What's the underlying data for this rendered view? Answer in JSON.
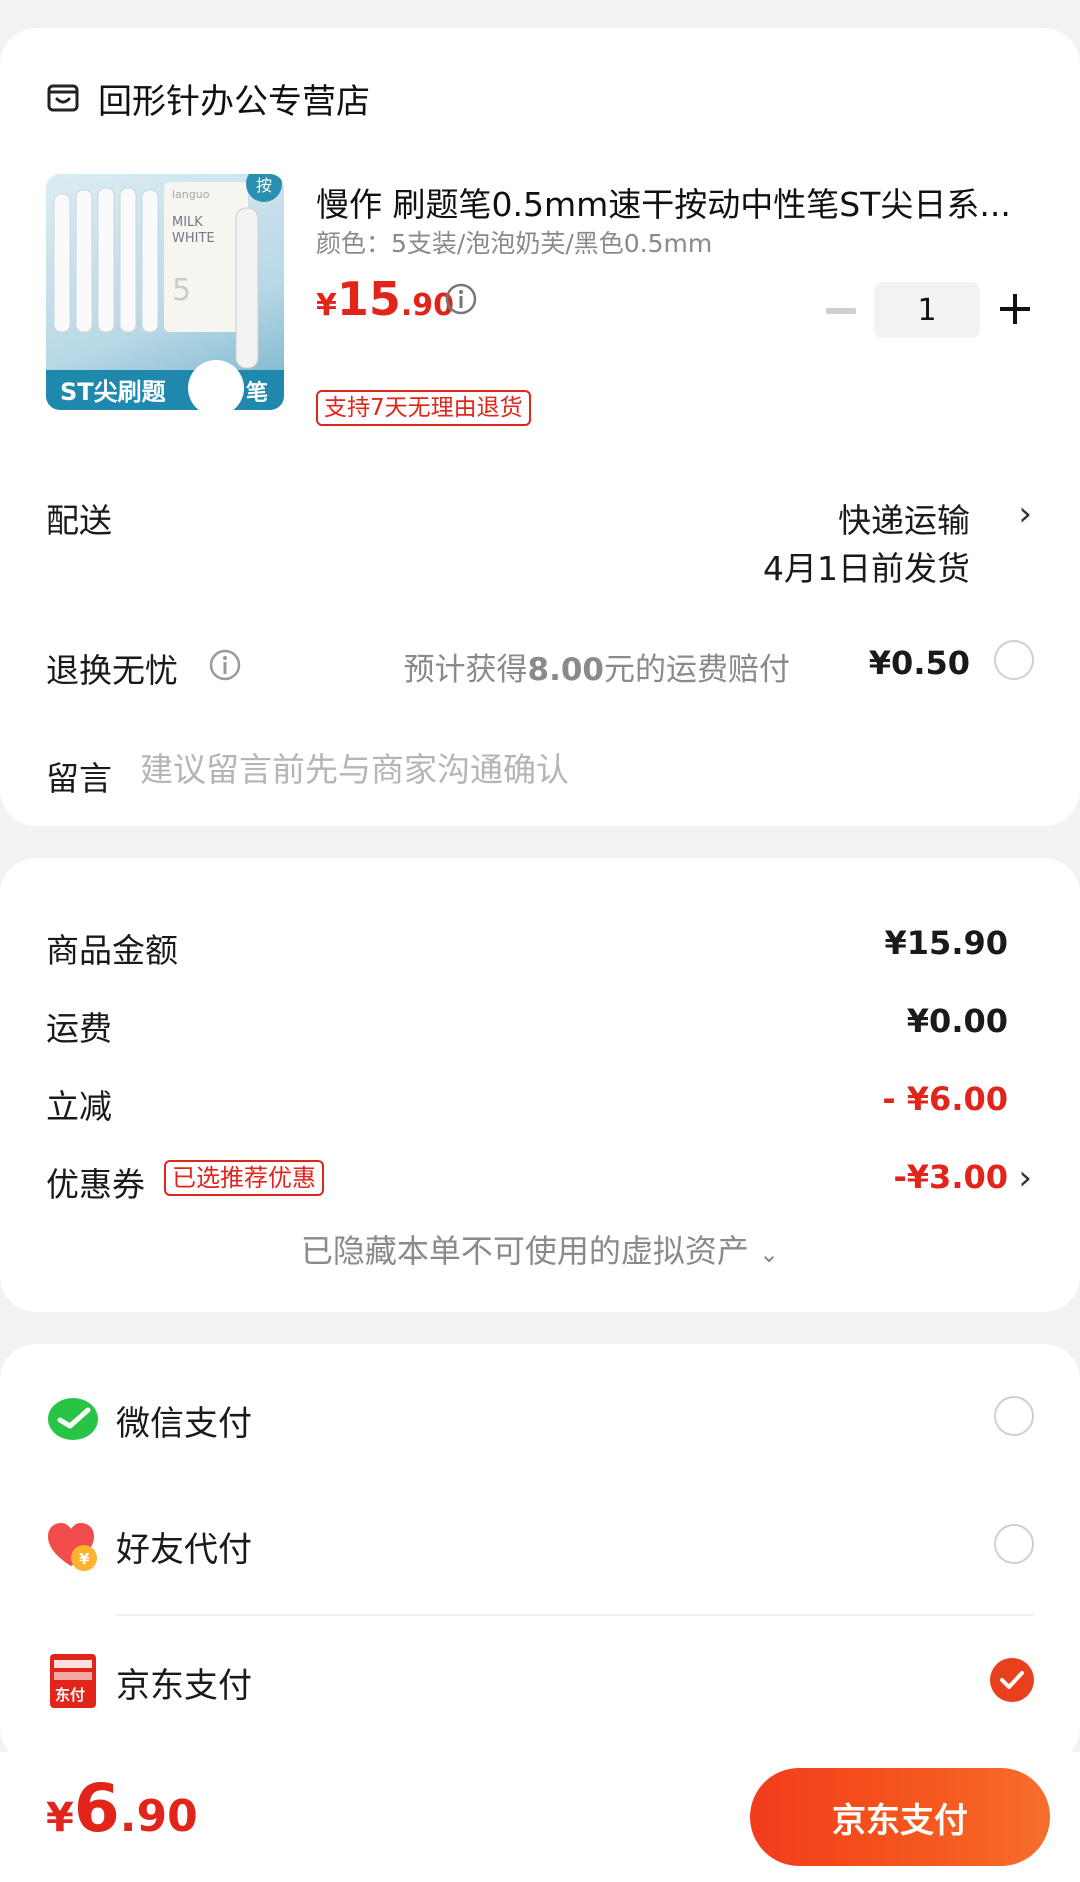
{
  "store": {
    "name": "回形针办公专营店",
    "icon": "store-icon"
  },
  "product": {
    "title": "慢作 刷题笔0.5mm速干按动中性笔ST尖日系...",
    "spec": "颜色：5支装/泡泡奶芙/黑色0.5mm",
    "price": {
      "currency": "¥",
      "integer": "15",
      "decimal": ".90"
    },
    "thumb_text": {
      "brand": "languo",
      "milk": "MILK",
      "white": "WHITE",
      "press": "按",
      "bottom_left": "ST尖刷题",
      "bottom_right": "笔",
      "count": "5"
    },
    "quantity": "1",
    "return_tag": "支持7天无理由退货"
  },
  "delivery": {
    "label": "配送",
    "method": "快递运输",
    "eta": "4月1日前发货"
  },
  "return_worry": {
    "label": "退换无忧",
    "desc_prefix": "预计获得",
    "desc_amount": "8.00",
    "desc_suffix": "元的运费赔付",
    "price": "¥0.50"
  },
  "message": {
    "label": "留言",
    "placeholder": "建议留言前先与商家沟通确认"
  },
  "summary": {
    "goods_label": "商品金额",
    "goods_value": "¥15.90",
    "shipping_label": "运费",
    "shipping_value": "¥0.00",
    "discount_label": "立减",
    "discount_value": "- ¥6.00",
    "coupon_label": "优惠券",
    "coupon_tag": "已选推荐优惠",
    "coupon_value": "-¥3.00",
    "hidden_assets": "已隐藏本单不可使用的虚拟资产"
  },
  "payment": {
    "methods": [
      {
        "label": "微信支付",
        "icon": "wechat-icon",
        "selected": false
      },
      {
        "label": "好友代付",
        "icon": "friend-pay-icon",
        "selected": false
      },
      {
        "label": "京东支付",
        "icon": "jd-pay-icon",
        "selected": true
      }
    ],
    "jd_icon_text": "东付"
  },
  "footer": {
    "total": {
      "currency": "¥",
      "integer": "6",
      "decimal": ".90"
    },
    "pay_button": "京东支付"
  },
  "colors": {
    "accent": "#e1251b",
    "button": "#f23c1c",
    "wechat": "#28c445"
  }
}
